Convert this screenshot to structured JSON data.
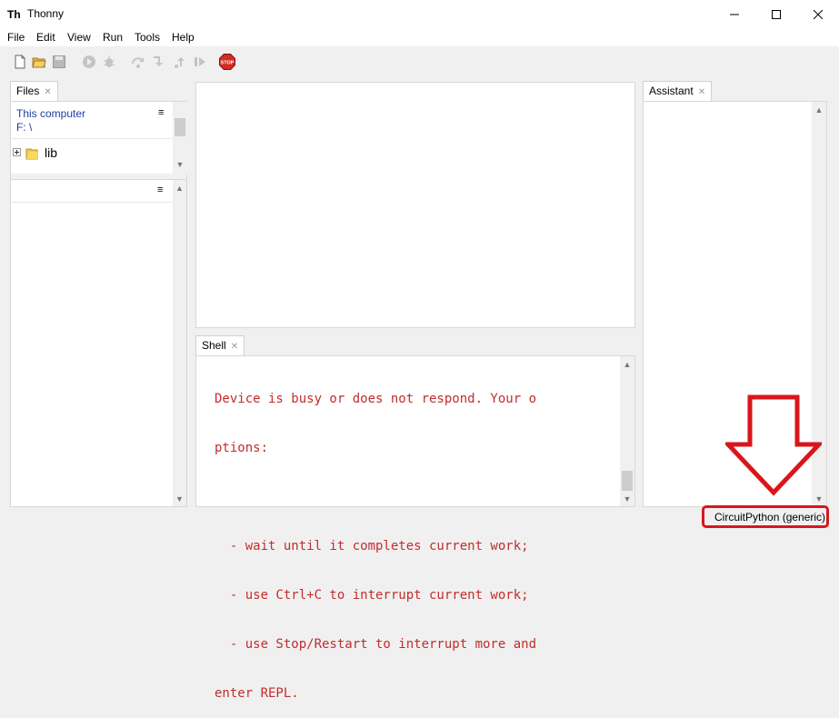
{
  "window": {
    "title": "Thonny",
    "minimize_icon": "minimize-icon",
    "maximize_icon": "maximize-icon",
    "close_icon": "close-icon"
  },
  "menu": [
    "File",
    "Edit",
    "View",
    "Run",
    "Tools",
    "Help"
  ],
  "toolbar": [
    "new-file-icon",
    "open-folder-icon",
    "save-icon",
    "run-icon",
    "debug-icon",
    "step-over-icon",
    "step-into-icon",
    "step-out-icon",
    "resume-icon",
    "stop-icon"
  ],
  "stop_label": "STOP",
  "files": {
    "tab_label": "Files",
    "location_label": "This computer",
    "path": "F: \\",
    "items": [
      {
        "name": "lib",
        "icon": "folder-icon"
      }
    ]
  },
  "shell": {
    "tab_label": "Shell",
    "lines": [
      "Device is busy or does not respond. Your o",
      "ptions:",
      "",
      "  - wait until it completes current work;",
      "  - use Ctrl+C to interrupt current work;",
      "  - use Stop/Restart to interrupt more and",
      "enter REPL."
    ]
  },
  "assistant": {
    "tab_label": "Assistant"
  },
  "status_bar": {
    "interpreter": "CircuitPython (generic)"
  },
  "colors": {
    "shell_text": "#c32c2c",
    "annotation": "#d9161c"
  },
  "annotation_icon": "down-arrow-icon"
}
